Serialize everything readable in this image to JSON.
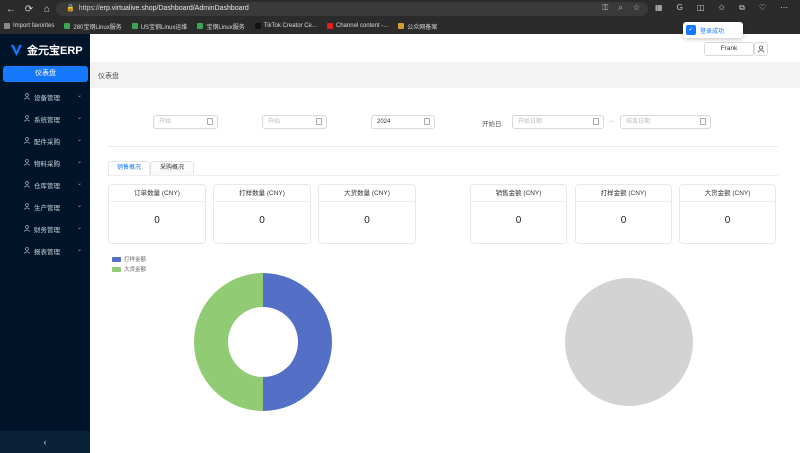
{
  "browser": {
    "url_scheme": "https://",
    "url_rest": "erp.virtualive.shop/Dashboard/AdminDashboard",
    "bookmarks": [
      {
        "label": "Import favorites",
        "color": "#8a8a8a"
      },
      {
        "label": "280宝钢Linux服务",
        "color": "#3aa655"
      },
      {
        "label": "US宝钢Linux运维",
        "color": "#3aa655"
      },
      {
        "label": "宝钢Linux服务",
        "color": "#3aa655"
      },
      {
        "label": "TikTok Creator Ce...",
        "color": "#111111"
      },
      {
        "label": "Channel content -...",
        "color": "#e02020"
      },
      {
        "label": "公众网备案",
        "color": "#d89a2b"
      }
    ]
  },
  "sidebar": {
    "logo_text": "金元宝ERP",
    "active_item": "仪表盘",
    "items": [
      {
        "label": "设备管理"
      },
      {
        "label": "系统管理"
      },
      {
        "label": "配件采购"
      },
      {
        "label": "物料采购"
      },
      {
        "label": "仓库管理"
      },
      {
        "label": "生产管理"
      },
      {
        "label": "财务管理"
      },
      {
        "label": "报表管理"
      }
    ],
    "collapse_glyph": "‹"
  },
  "header": {
    "user_name": "Frank",
    "toast_text": "登录成功"
  },
  "breadcrumb": "仪表盘",
  "filters": {
    "field1_placeholder": "开始",
    "field2_placeholder": "开始",
    "year_value": "2024",
    "range_label": "开始日:",
    "range_start_placeholder": "开始日期",
    "range_sep": "→",
    "range_end_placeholder": "结束日期"
  },
  "tabs": [
    {
      "label": "销售概况",
      "active": true
    },
    {
      "label": "采购概况",
      "active": false
    }
  ],
  "cards_left": [
    {
      "title": "订单数量 (CNY)",
      "value": "0"
    },
    {
      "title": "打样数量 (CNY)",
      "value": "0"
    },
    {
      "title": "大货数量 (CNY)",
      "value": "0"
    }
  ],
  "cards_right": [
    {
      "title": "销售金额 (CNY)",
      "value": "0"
    },
    {
      "title": "打样金额 (CNY)",
      "value": "0"
    },
    {
      "title": "大货金额 (CNY)",
      "value": "0"
    }
  ],
  "chart_data": [
    {
      "type": "pie",
      "legend": [
        "打样金额",
        "大货金额"
      ],
      "legend_placement": "top-left",
      "values": [
        1,
        1
      ],
      "colors": [
        "#5470c6",
        "#91cc75"
      ],
      "donut": true
    },
    {
      "type": "pie",
      "values": [
        1
      ],
      "colors": [
        "#d3d3d3"
      ],
      "donut": false
    }
  ],
  "colors": {
    "sidebar_bg": "#001529",
    "accent": "#1677ff"
  }
}
